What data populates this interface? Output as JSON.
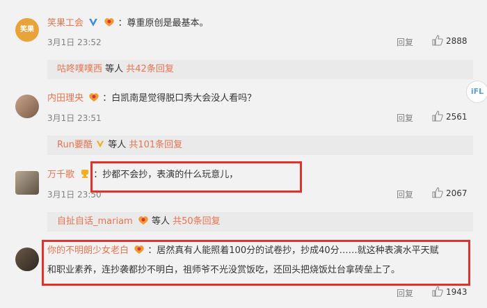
{
  "comments": [
    {
      "name": "笑果工会",
      "text": "：尊重原创是最基本。",
      "time": "3月1日 23:52",
      "reply": "回复",
      "likes": "2888",
      "avatar_text": "笑果",
      "sub": {
        "name": "咕咚噗噗西",
        "mid": " 等人 ",
        "count": "共42条回复"
      }
    },
    {
      "name": "内田理央",
      "text": "：白凯南是觉得脱口秀大会没人看吗？",
      "time": "3月1日 23:51",
      "reply": "回复",
      "likes": "2561",
      "sub": {
        "name": "Run要酷",
        "mid": " 等人 ",
        "count": "共101条回复"
      }
    },
    {
      "name": "万千歌",
      "text": "：抄都不会抄，表演的什么玩意儿，",
      "time": "3月1日 23:50",
      "reply": "回复",
      "likes": "2067",
      "sub": {
        "name": "自扯自话_mariam",
        "mid": " 等人 ",
        "count": "共50条回复"
      }
    },
    {
      "name": "你的不明朗少女老白",
      "text_line1": "：居然真有人能照着100分的试卷抄，抄成40分……就这种表演水平天赋",
      "text_line2": "和职业素养，连抄袭都抄不明白，祖师爷不光没赏饭吃，还回头把烧饭灶台拿砖垒上了。",
      "reply": "回复",
      "likes": "1943"
    }
  ],
  "side_badge": "iFL",
  "colors": {
    "name": "#eb7350",
    "highlight": "#e0322c",
    "subbar": "#eaeaea",
    "verified": "#3b8de0"
  }
}
